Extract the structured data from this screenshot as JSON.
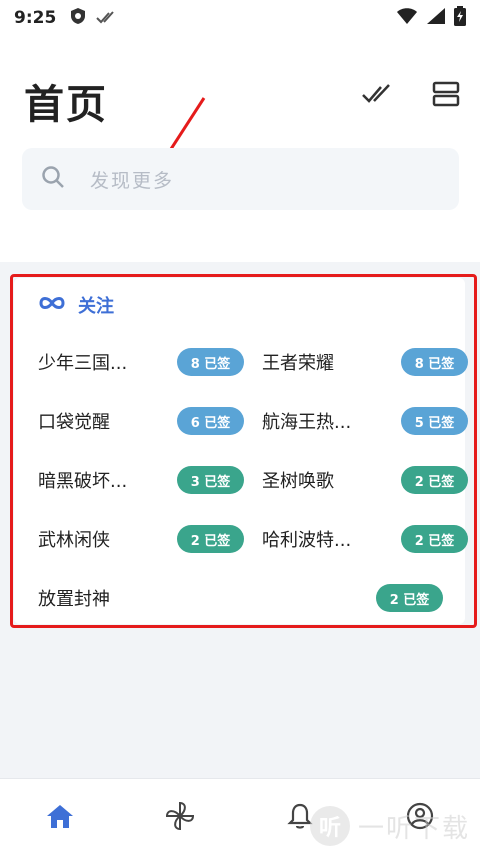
{
  "status": {
    "time": "9:25"
  },
  "header": {
    "title": "首页"
  },
  "search": {
    "placeholder": "发现更多"
  },
  "section": {
    "title": "关注"
  },
  "items": [
    {
      "name": "少年三国...",
      "badge": "8 已签",
      "badge_color": "#5aa4d6"
    },
    {
      "name": "王者荣耀",
      "badge": "8 已签",
      "badge_color": "#5aa4d6"
    },
    {
      "name": "口袋觉醒",
      "badge": "6 已签",
      "badge_color": "#5aa4d6"
    },
    {
      "name": "航海王热...",
      "badge": "5 已签",
      "badge_color": "#5aa4d6"
    },
    {
      "name": "暗黑破坏...",
      "badge": "3 已签",
      "badge_color": "#3aa58c"
    },
    {
      "name": "圣树唤歌",
      "badge": "2 已签",
      "badge_color": "#3aa58c"
    },
    {
      "name": "武林闲侠",
      "badge": "2 已签",
      "badge_color": "#3aa58c"
    },
    {
      "name": "哈利波特...",
      "badge": "2 已签",
      "badge_color": "#3aa58c"
    },
    {
      "name": "放置封神",
      "badge": "2 已签",
      "badge_color": "#3aa58c"
    }
  ],
  "colors": {
    "accent": "#3e6fd6",
    "highlight": "#e51b1b"
  },
  "nav": {
    "icons": [
      "home-icon",
      "pinwheel-icon",
      "bell-icon",
      "profile-icon"
    ]
  },
  "watermark": {
    "glyph": "听",
    "text": "一听下载"
  }
}
